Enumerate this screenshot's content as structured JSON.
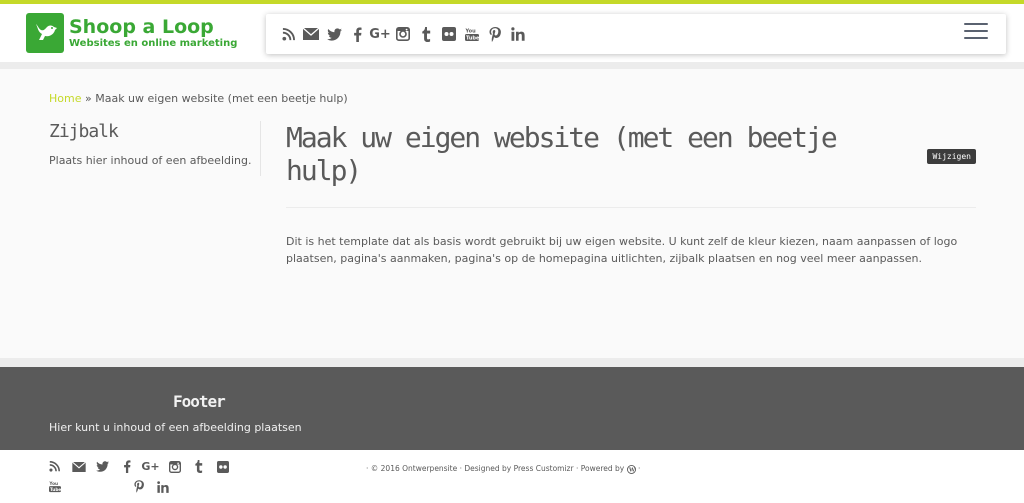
{
  "brand": {
    "title": "Shoop a Loop",
    "subtitle": "Websites en online marketing",
    "color": "#3aa835"
  },
  "accent_color": "#c5d929",
  "header": {
    "social_icons": [
      "rss-icon",
      "email-icon",
      "twitter-icon",
      "facebook-icon",
      "google-plus-icon",
      "instagram-icon",
      "tumblr-icon",
      "flickr-icon",
      "youtube-icon",
      "pinterest-icon",
      "linkedin-icon"
    ],
    "google_plus_glyph": "G+",
    "menu_icon": "hamburger-menu-icon"
  },
  "breadcrumb": {
    "home": "Home",
    "separator": "»",
    "current": "Maak uw eigen website (met een beetje hulp)"
  },
  "sidebar": {
    "title": "Zijbalk",
    "text": "Plaats hier inhoud of een afbeelding."
  },
  "content": {
    "title": "Maak uw eigen website (met een beetje hulp)",
    "edit_label": "Wijzigen",
    "body": "Dit is het template dat als basis wordt gebruikt bij uw eigen website. U kunt zelf de kleur kiezen, naam aanpassen of logo plaatsen, pagina's aanmaken, pagina's op de homepagina uitlichten, zijbalk plaatsen en nog veel meer aanpassen."
  },
  "footer": {
    "title": "Footer",
    "text": "Hier kunt u inhoud of een afbeelding plaatsen"
  },
  "colophon": {
    "social_icons": [
      "rss-icon",
      "email-icon",
      "twitter-icon",
      "facebook-icon",
      "google-plus-icon",
      "instagram-icon",
      "tumblr-icon",
      "flickr-icon",
      "youtube-icon",
      "pinterest-icon",
      "linkedin-icon"
    ],
    "google_plus_glyph": "G+",
    "credits_copyright": "· © 2016 Ontwerpensite · Designed by Press Customizr · Powered by",
    "credits_end": "·"
  }
}
